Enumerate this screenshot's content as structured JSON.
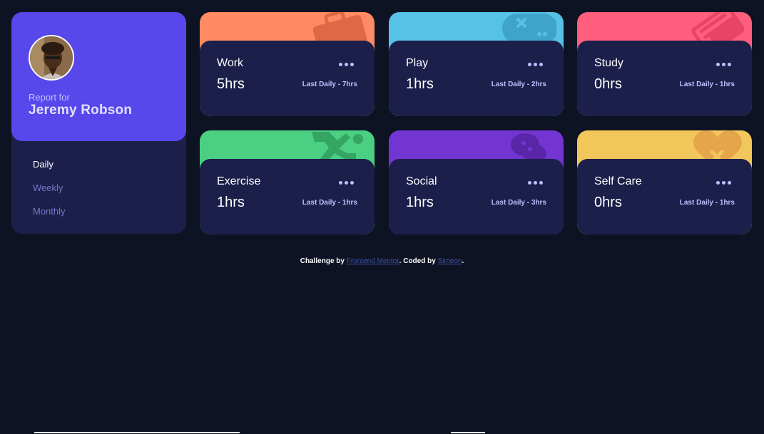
{
  "profile": {
    "report_label": "Report for",
    "name": "Jeremy Robson",
    "avatar_icon": "user-avatar"
  },
  "timeframes": [
    {
      "label": "Daily",
      "active": true
    },
    {
      "label": "Weekly",
      "active": false
    },
    {
      "label": "Monthly",
      "active": false
    }
  ],
  "cards": [
    {
      "title": "Work",
      "hours": "5hrs",
      "previous": "Last Daily - 7hrs",
      "color": "#ff8b64",
      "icon": "briefcase-icon"
    },
    {
      "title": "Play",
      "hours": "1hrs",
      "previous": "Last Daily - 2hrs",
      "color": "#55c2e6",
      "icon": "gamepad-icon"
    },
    {
      "title": "Study",
      "hours": "0hrs",
      "previous": "Last Daily - 1hrs",
      "color": "#ff5e7d",
      "icon": "book-icon"
    },
    {
      "title": "Exercise",
      "hours": "1hrs",
      "previous": "Last Daily - 1hrs",
      "color": "#4bcf82",
      "icon": "running-icon"
    },
    {
      "title": "Social",
      "hours": "1hrs",
      "previous": "Last Daily - 3hrs",
      "color": "#7335d2",
      "icon": "chat-bubble-icon"
    },
    {
      "title": "Self Care",
      "hours": "0hrs",
      "previous": "Last Daily - 1hrs",
      "color": "#f1c75b",
      "icon": "heart-icon"
    }
  ],
  "footer": {
    "prefix": "Challenge by ",
    "link1": "Frontend Mentor",
    "middle": ". Coded by ",
    "link2": "Simeon",
    "suffix": ".",
    "link_color": "#3e52a3"
  }
}
